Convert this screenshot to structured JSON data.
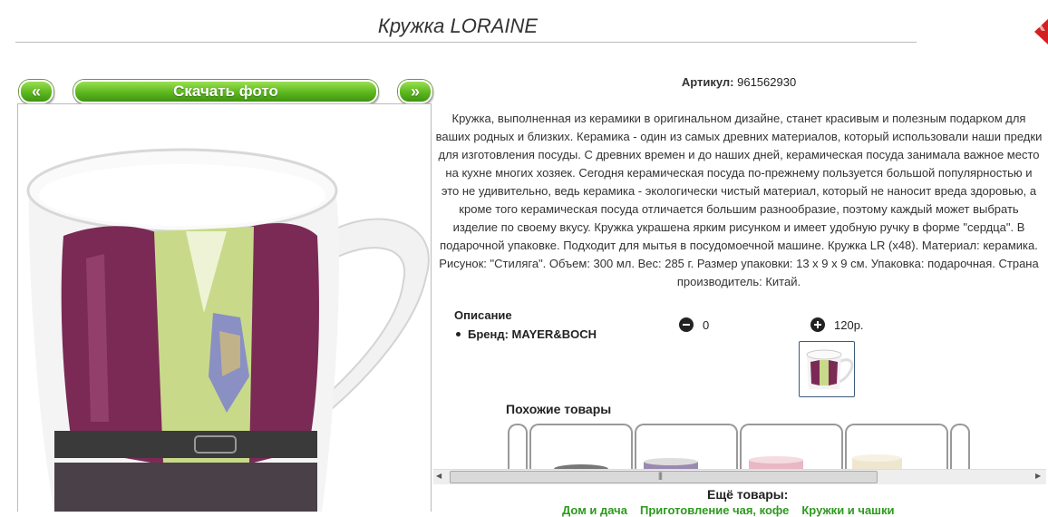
{
  "header": {
    "title": "Кружка LORAINE"
  },
  "gallery": {
    "prev_label": "«",
    "download_label": "Скачать фото",
    "next_label": "»"
  },
  "product": {
    "sku_label": "Артикул:",
    "sku_value": "961562930",
    "description": "Кружка, выполненная из керамики в оригинальном дизайне, станет красивым и полезным подарком для ваших родных и близких. Керамика - один из самых древних материалов, который использовали наши предки для изготовления посуды. С древних времен и до наших дней, керамическая посуда занимала важное место на кухне многих хозяек. Сегодня керамическая посуда по-прежнему пользуется большой популярностью и это не удивительно, ведь керамика - экологически чистый материал, который не наносит вреда здоровью, а кроме того керамическая посуда отличается большим разнообразие, поэтому каждый может выбрать изделие по своему вкусу. Кружка украшена ярким рисунком и имеет удобную ручку в форме \"сердца\". В подарочной упаковке. Подходит для мытья в посудомоечной машине. Кружка LR (x48). Материал: керамика. Рисунок: \"Стиляга\". Объем: 300 мл. Вес: 285 г. Размер упаковки: 13 x 9 x 9 см. Упаковка: подарочная. Страна производитель: Китай.",
    "specs_heading": "Описание",
    "brand_text": "Бренд: MAYER&BOCH",
    "quantity": "0",
    "price": "120р."
  },
  "similar": {
    "heading": "Похожие товары"
  },
  "more": {
    "heading": "Ещё товары:",
    "links": [
      "Дом и дача",
      "Приготовление чая, кофе",
      "Кружки и чашки"
    ]
  },
  "colors": {
    "button_green": "#5cb71e",
    "close_red": "#d42020",
    "link_green": "#2d9a1e"
  },
  "icons": {
    "close": "close-icon",
    "minus": "minus-circle-icon",
    "plus": "plus-circle-icon",
    "scroll_grip": "grip-icon"
  }
}
